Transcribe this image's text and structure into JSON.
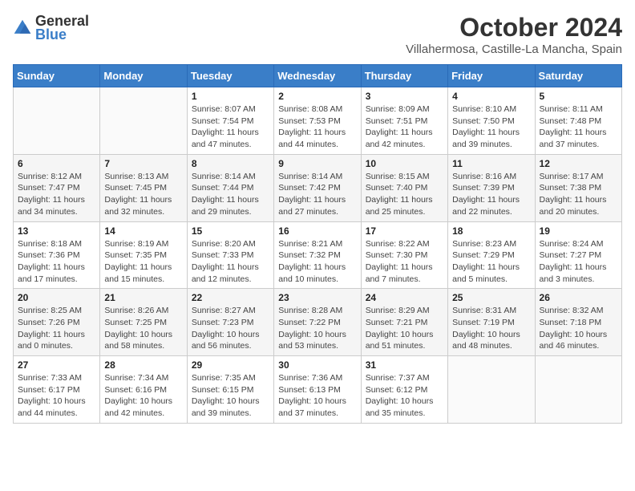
{
  "header": {
    "logo_general": "General",
    "logo_blue": "Blue",
    "title": "October 2024",
    "location": "Villahermosa, Castille-La Mancha, Spain"
  },
  "weekdays": [
    "Sunday",
    "Monday",
    "Tuesday",
    "Wednesday",
    "Thursday",
    "Friday",
    "Saturday"
  ],
  "weeks": [
    [
      {
        "day": "",
        "info": ""
      },
      {
        "day": "",
        "info": ""
      },
      {
        "day": "1",
        "info": "Sunrise: 8:07 AM\nSunset: 7:54 PM\nDaylight: 11 hours and 47 minutes."
      },
      {
        "day": "2",
        "info": "Sunrise: 8:08 AM\nSunset: 7:53 PM\nDaylight: 11 hours and 44 minutes."
      },
      {
        "day": "3",
        "info": "Sunrise: 8:09 AM\nSunset: 7:51 PM\nDaylight: 11 hours and 42 minutes."
      },
      {
        "day": "4",
        "info": "Sunrise: 8:10 AM\nSunset: 7:50 PM\nDaylight: 11 hours and 39 minutes."
      },
      {
        "day": "5",
        "info": "Sunrise: 8:11 AM\nSunset: 7:48 PM\nDaylight: 11 hours and 37 minutes."
      }
    ],
    [
      {
        "day": "6",
        "info": "Sunrise: 8:12 AM\nSunset: 7:47 PM\nDaylight: 11 hours and 34 minutes."
      },
      {
        "day": "7",
        "info": "Sunrise: 8:13 AM\nSunset: 7:45 PM\nDaylight: 11 hours and 32 minutes."
      },
      {
        "day": "8",
        "info": "Sunrise: 8:14 AM\nSunset: 7:44 PM\nDaylight: 11 hours and 29 minutes."
      },
      {
        "day": "9",
        "info": "Sunrise: 8:14 AM\nSunset: 7:42 PM\nDaylight: 11 hours and 27 minutes."
      },
      {
        "day": "10",
        "info": "Sunrise: 8:15 AM\nSunset: 7:40 PM\nDaylight: 11 hours and 25 minutes."
      },
      {
        "day": "11",
        "info": "Sunrise: 8:16 AM\nSunset: 7:39 PM\nDaylight: 11 hours and 22 minutes."
      },
      {
        "day": "12",
        "info": "Sunrise: 8:17 AM\nSunset: 7:38 PM\nDaylight: 11 hours and 20 minutes."
      }
    ],
    [
      {
        "day": "13",
        "info": "Sunrise: 8:18 AM\nSunset: 7:36 PM\nDaylight: 11 hours and 17 minutes."
      },
      {
        "day": "14",
        "info": "Sunrise: 8:19 AM\nSunset: 7:35 PM\nDaylight: 11 hours and 15 minutes."
      },
      {
        "day": "15",
        "info": "Sunrise: 8:20 AM\nSunset: 7:33 PM\nDaylight: 11 hours and 12 minutes."
      },
      {
        "day": "16",
        "info": "Sunrise: 8:21 AM\nSunset: 7:32 PM\nDaylight: 11 hours and 10 minutes."
      },
      {
        "day": "17",
        "info": "Sunrise: 8:22 AM\nSunset: 7:30 PM\nDaylight: 11 hours and 7 minutes."
      },
      {
        "day": "18",
        "info": "Sunrise: 8:23 AM\nSunset: 7:29 PM\nDaylight: 11 hours and 5 minutes."
      },
      {
        "day": "19",
        "info": "Sunrise: 8:24 AM\nSunset: 7:27 PM\nDaylight: 11 hours and 3 minutes."
      }
    ],
    [
      {
        "day": "20",
        "info": "Sunrise: 8:25 AM\nSunset: 7:26 PM\nDaylight: 11 hours and 0 minutes."
      },
      {
        "day": "21",
        "info": "Sunrise: 8:26 AM\nSunset: 7:25 PM\nDaylight: 10 hours and 58 minutes."
      },
      {
        "day": "22",
        "info": "Sunrise: 8:27 AM\nSunset: 7:23 PM\nDaylight: 10 hours and 56 minutes."
      },
      {
        "day": "23",
        "info": "Sunrise: 8:28 AM\nSunset: 7:22 PM\nDaylight: 10 hours and 53 minutes."
      },
      {
        "day": "24",
        "info": "Sunrise: 8:29 AM\nSunset: 7:21 PM\nDaylight: 10 hours and 51 minutes."
      },
      {
        "day": "25",
        "info": "Sunrise: 8:31 AM\nSunset: 7:19 PM\nDaylight: 10 hours and 48 minutes."
      },
      {
        "day": "26",
        "info": "Sunrise: 8:32 AM\nSunset: 7:18 PM\nDaylight: 10 hours and 46 minutes."
      }
    ],
    [
      {
        "day": "27",
        "info": "Sunrise: 7:33 AM\nSunset: 6:17 PM\nDaylight: 10 hours and 44 minutes."
      },
      {
        "day": "28",
        "info": "Sunrise: 7:34 AM\nSunset: 6:16 PM\nDaylight: 10 hours and 42 minutes."
      },
      {
        "day": "29",
        "info": "Sunrise: 7:35 AM\nSunset: 6:15 PM\nDaylight: 10 hours and 39 minutes."
      },
      {
        "day": "30",
        "info": "Sunrise: 7:36 AM\nSunset: 6:13 PM\nDaylight: 10 hours and 37 minutes."
      },
      {
        "day": "31",
        "info": "Sunrise: 7:37 AM\nSunset: 6:12 PM\nDaylight: 10 hours and 35 minutes."
      },
      {
        "day": "",
        "info": ""
      },
      {
        "day": "",
        "info": ""
      }
    ]
  ]
}
